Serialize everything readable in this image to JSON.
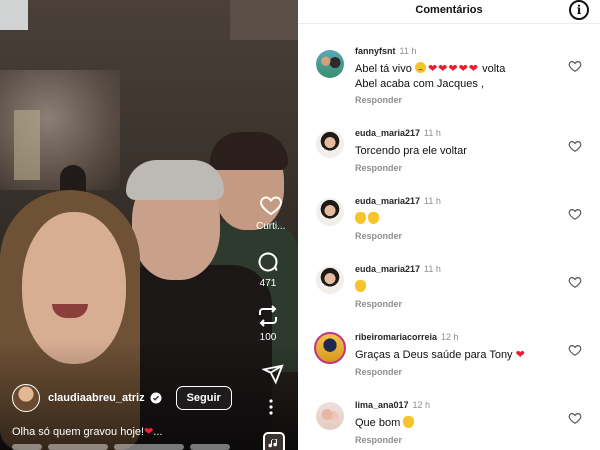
{
  "video": {
    "author": "claudiaabreu_atriz",
    "follow_label": "Seguir",
    "caption": "Olha só quem gravou hoje!",
    "caption_suffix": "...",
    "actions": {
      "like_label": "Curti...",
      "comments_count": "471",
      "reposts_count": "100"
    }
  },
  "comments_panel": {
    "title": "Comentários",
    "reply_label": "Responder",
    "items": [
      {
        "user": "fannyfsnt",
        "time": "11 h",
        "text_before": "Abel tá vivo",
        "text_hearts": "❤❤❤❤❤",
        "text_after": "volta",
        "text_line2": "Abel acaba com Jacques ,"
      },
      {
        "user": "euda_maria217",
        "time": "11 h",
        "text": "Torcendo pra ele voltar"
      },
      {
        "user": "euda_maria217",
        "time": "11 h"
      },
      {
        "user": "euda_maria217",
        "time": "11 h"
      },
      {
        "user": "ribeiromariacorreia",
        "time": "12 h",
        "text": "Graças a Deus saúde para Tony",
        "text_heart": "❤"
      },
      {
        "user": "lima_ana017",
        "time": "12 h",
        "text": "Que bom"
      }
    ]
  },
  "icons": {
    "info": "info-icon",
    "heart": "heart-outline-icon",
    "comment": "comment-bubble-icon",
    "repost": "repost-icon",
    "send": "paper-plane-icon",
    "more": "more-vertical-icon",
    "audio": "music-note-icon",
    "verified": "verified-badge-icon"
  },
  "colors": {
    "heart_red": "#ed1c2e",
    "muted_text": "#8e8e8e",
    "verified_blue": "#3897f0"
  }
}
